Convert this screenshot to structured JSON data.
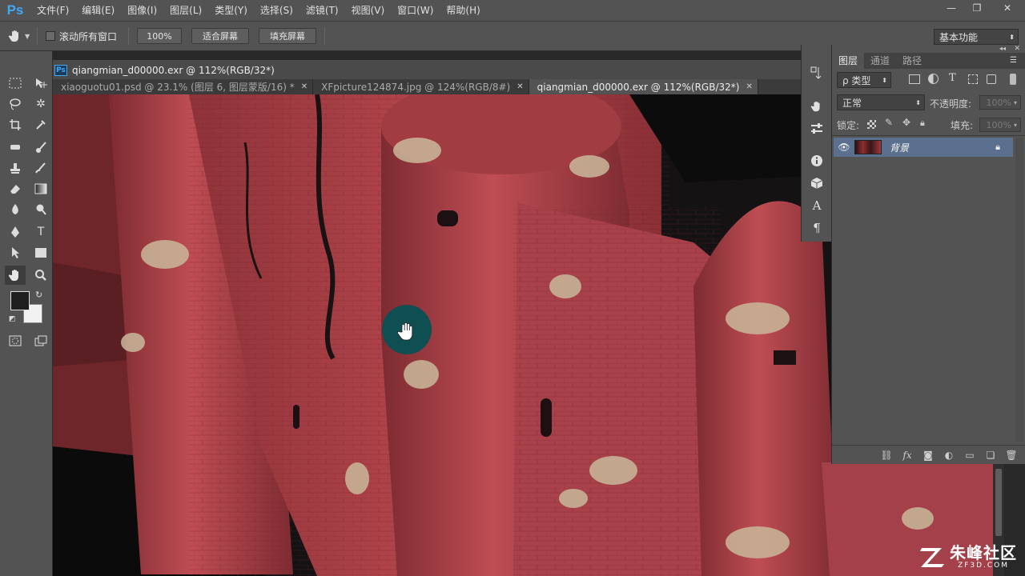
{
  "app": {
    "logo": "Ps",
    "menus": [
      "文件(F)",
      "编辑(E)",
      "图像(I)",
      "图层(L)",
      "类型(Y)",
      "选择(S)",
      "滤镜(T)",
      "视图(V)",
      "窗口(W)",
      "帮助(H)"
    ],
    "window_controls": [
      "—",
      "❐",
      "✕"
    ]
  },
  "options_bar": {
    "scroll_all_label": "滚动所有窗口",
    "zoom_100": "100%",
    "fit_screen": "适合屏幕",
    "fill_screen": "填充屏幕",
    "workspace": "基本功能"
  },
  "document": {
    "title": "qiangmian_d00000.exr @ 112%(RGB/32*)",
    "tabs": [
      {
        "label": "xiaoguotu01.psd @ 23.1% (图层 6, 图层蒙版/16) *",
        "active": false
      },
      {
        "label": "XFpicture124874.jpg @ 124%(RGB/8#)",
        "active": false
      },
      {
        "label": "qiangmian_d00000.exr @ 112%(RGB/32*)",
        "active": true
      }
    ]
  },
  "layers_panel": {
    "tabs": [
      "图层",
      "通道",
      "路径"
    ],
    "filter_type": "ρ 类型",
    "blend_mode": "正常",
    "opacity_label": "不透明度:",
    "opacity_value": "100%",
    "lock_label": "锁定:",
    "fill_label": "填充:",
    "fill_value": "100%",
    "layer_name": "背景"
  },
  "watermark": {
    "brand": "朱峰社区",
    "url": "ZF3D.COM"
  },
  "colors": {
    "accent": "#3fa9f5",
    "layer_selected": "#5b6f8e",
    "cursor_highlight": "#0f4f52",
    "wall_red": "#b0434a"
  }
}
